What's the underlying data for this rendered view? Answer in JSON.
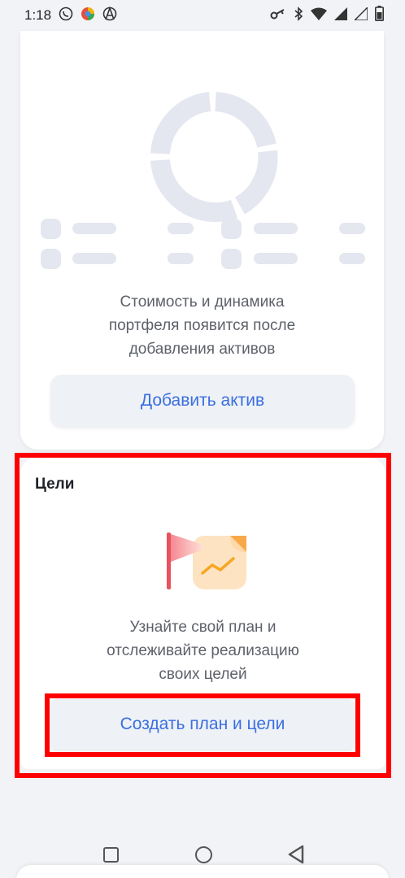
{
  "status_bar": {
    "time": "1:18"
  },
  "portfolio": {
    "empty_text_line1": "Стоимость и динамика",
    "empty_text_line2": "портфеля появится после",
    "empty_text_line3": "добавления активов",
    "add_asset_label": "Добавить актив"
  },
  "goals": {
    "title": "Цели",
    "text_line1": "Узнайте свой план и",
    "text_line2": "отслеживайте реализацию",
    "text_line3": "своих целей",
    "create_plan_label": "Создать план и цели"
  },
  "colors": {
    "accent": "#3b6fe0",
    "highlight": "#ff0000",
    "skeleton": "#e4e7ef"
  },
  "icons": [
    "whatsapp-icon",
    "color-circle-icon",
    "anarchy-icon",
    "key-icon",
    "bluetooth-icon",
    "wifi-icon",
    "signal-icon",
    "signal-icon",
    "battery-icon",
    "flag-chart-illustration",
    "square-nav-icon",
    "circle-nav-icon",
    "triangle-nav-icon"
  ]
}
